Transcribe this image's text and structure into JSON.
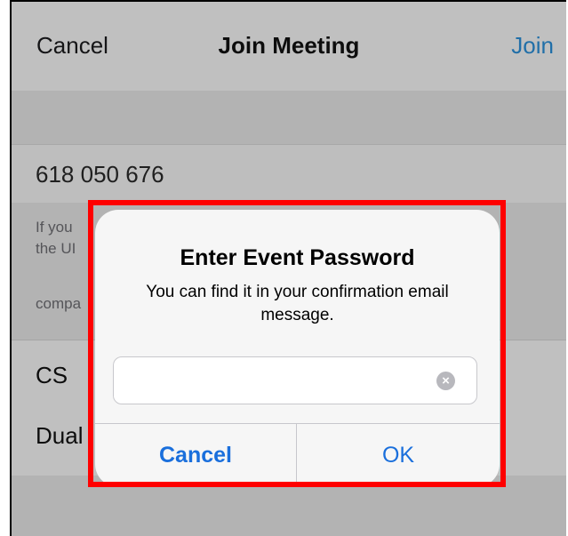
{
  "nav": {
    "cancel_label": "Cancel",
    "title": "Join Meeting",
    "join_label": "Join"
  },
  "meeting": {
    "id": "618 050 676"
  },
  "info": {
    "line1": "If you",
    "line2": "the UI",
    "line3": "compa"
  },
  "rows": {
    "cs": "CS",
    "dual": "Dual"
  },
  "dialog": {
    "title": "Enter Event Password",
    "message": "You can find it in your confirmation email message.",
    "password_value": "",
    "clear_glyph": "×",
    "cancel_label": "Cancel",
    "ok_label": "OK"
  },
  "colors": {
    "accent": "#1a6fdc",
    "nav_link": "#2b8fd8",
    "highlight": "#ff0000"
  }
}
